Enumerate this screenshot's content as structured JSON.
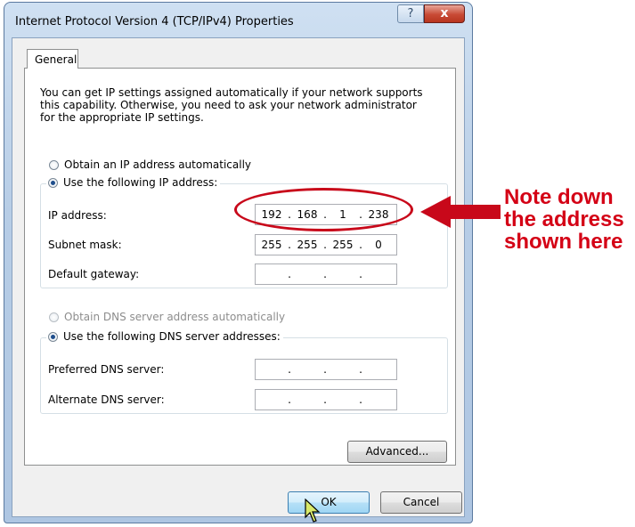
{
  "window": {
    "title": "Internet Protocol Version 4 (TCP/IPv4) Properties",
    "help_glyph": "?",
    "close_glyph": "x"
  },
  "tabs": [
    {
      "label": "General",
      "selected": true
    }
  ],
  "general": {
    "description": "You can get IP settings assigned automatically if your network supports\nthis capability. Otherwise, you need to ask your network administrator\nfor the appropriate IP settings.",
    "ip_auto_label": "Obtain an IP address automatically",
    "ip_manual_label": "Use the following IP address:",
    "ip_fields": [
      {
        "label": "IP address:",
        "octets": [
          "192",
          "168",
          "1",
          "238"
        ]
      },
      {
        "label": "Subnet mask:",
        "octets": [
          "255",
          "255",
          "255",
          "0"
        ]
      },
      {
        "label": "Default gateway:",
        "octets": [
          "",
          "",
          "",
          ""
        ]
      }
    ],
    "dns_auto_label": "Obtain DNS server address automatically",
    "dns_manual_label": "Use the following DNS server addresses:",
    "dns_fields": [
      {
        "label": "Preferred DNS server:",
        "octets": [
          "",
          "",
          "",
          ""
        ]
      },
      {
        "label": "Alternate DNS server:",
        "octets": [
          "",
          "",
          "",
          ""
        ]
      }
    ],
    "advanced_button": "Advanced..."
  },
  "buttons": {
    "ok": "OK",
    "cancel": "Cancel"
  },
  "annotation": {
    "text": "Note down\nthe address\nshown here",
    "color": "#d40015"
  },
  "colors": {
    "selection": "#1f4e8c",
    "annotation_red": "#c8081a"
  }
}
